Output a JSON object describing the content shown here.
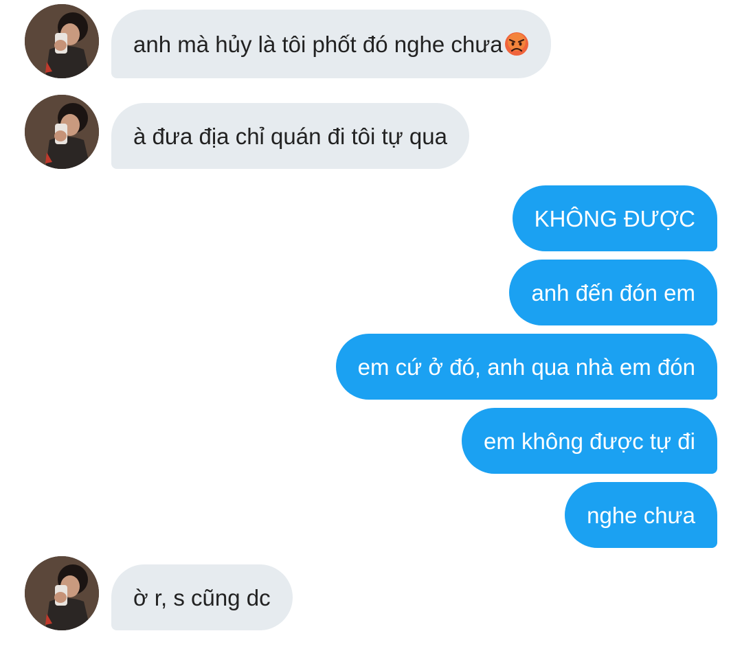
{
  "conversation": {
    "messages": [
      {
        "side": "in",
        "text": "anh mà hủy là tôi phốt đó nghe chưa",
        "emoji": "angry-face-icon"
      },
      {
        "side": "in",
        "text": "à đưa địa chỉ quán đi tôi tự qua"
      },
      {
        "side": "out",
        "text": "KHÔNG ĐƯỢC"
      },
      {
        "side": "out",
        "text": "anh đến đón em"
      },
      {
        "side": "out",
        "text": "em cứ ở đó, anh qua nhà em đón"
      },
      {
        "side": "out",
        "text": "em không được tự đi"
      },
      {
        "side": "out",
        "text": "nghe chưa"
      },
      {
        "side": "in",
        "text": "ờ r, s cũng dc"
      }
    ]
  },
  "colors": {
    "incoming_bubble": "#e6ebef",
    "outgoing_bubble": "#1ba1f2",
    "incoming_text": "#222222",
    "outgoing_text": "#ffffff",
    "background": "#ffffff"
  }
}
